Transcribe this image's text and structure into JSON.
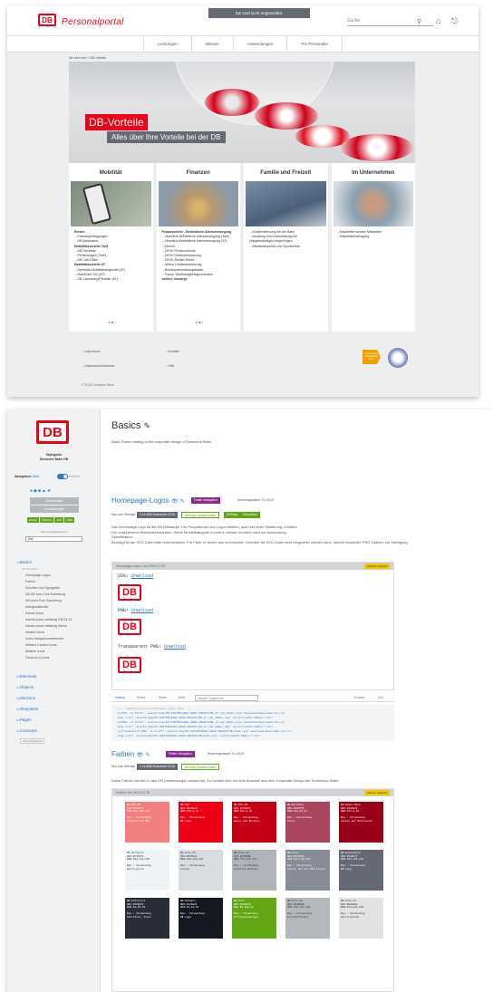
{
  "portal": {
    "logo": "DB",
    "title": "Personalportal",
    "banner": "Sie sind nicht angemeldet.",
    "search_placeholder": "Suche",
    "nav": [
      "Leistungen",
      "Wissen",
      "Anwendungen",
      "Für Personaler"
    ],
    "breadcrumb": "Sie sind hier: / DB-Vorteile",
    "hero_title": "DB-Vorteile",
    "hero_subtitle": "Alles über Ihre Vorteile bei der DB",
    "cards": [
      {
        "title": "Mobilität",
        "items": [
          {
            "h": "Reisen"
          },
          {
            "a": "Fahrvergünstigungen"
          },
          {
            "a": "DB Bahnmarkt"
          },
          {
            "h": "Mobilitätsvorteile Tarif"
          },
          {
            "a": "DB Fernreise"
          },
          {
            "a": "Firmenwagen (Tarif)"
          },
          {
            "a": "DB Call a Bike"
          },
          {
            "h": "Mobilitätsvorteile AT"
          },
          {
            "a": "Überblick Mobilitätsangebote (AT)"
          },
          {
            "a": "BahnCard 100 (AT)"
          },
          {
            "a": "DB Carsharing/Flinkster (AT)"
          }
        ]
      },
      {
        "title": "Finanzen",
        "items": [
          {
            "h": "Finanzvorteile - Betriebliche Altersversorgung"
          },
          {
            "a": "Überblick Betriebliche Altersversorgung (Tarif)"
          },
          {
            "a": "Überblick Betriebliche Altersversorgung (AT)"
          },
          {
            "a": "DirectV"
          },
          {
            "a": "DEVK Pensionsfonds"
          },
          {
            "a": "DEVK Direktversicherung"
          },
          {
            "a": "DEVK-Riester-Rente"
          },
          {
            "a": "Allianz Direktversicherung"
          },
          {
            "a": "Berufsunterstützungskasse"
          },
          {
            "a": "Fokus: Zinsflüssigkeitsgrundsätze"
          },
          {
            "h": "weitere Vorsorge"
          }
        ]
      },
      {
        "title": "Familie und Freizeit",
        "items": [
          {
            "a": "Kinderbetreuung bei der Bahn"
          },
          {
            "a": "Beratung und Unterstützung bei pflegebedürftigen Angehörigen"
          },
          {
            "a": "Mitarbeiterpreise und Sportevents"
          }
        ]
      },
      {
        "title": "Im Unternehmen",
        "items": [
          {
            "a": "Mitarbeiter werben Mitarbeiter"
          },
          {
            "a": "Mitarbeiterbefragung"
          }
        ]
      }
    ],
    "footer_links": [
      "Impressum",
      "Datenschutzhinweise",
      "Kontakt",
      "Hilfe"
    ],
    "copyright": "© 2015 Deutsche Bahn",
    "footer_badge": "Verbraucher Unternehmen Bahn"
  },
  "styleguide": {
    "logo": "DB",
    "title_line1": "Styleguide",
    "title_line2": "Deutsche Bahn HR",
    "navigation_label": "Navigation:",
    "navigation_state": "Aktiv",
    "navigation_alt": "Experimentell",
    "status_box1": "Übersichten",
    "status_box2": "Anwendungen",
    "tags": [
      "DOCK",
      "PORTAL",
      "APP",
      "CMS"
    ],
    "select_label": "Neue Layoutversionen",
    "select_value": "Alle",
    "sidebar_section": "Basics",
    "sidebar_sub": "All Templates",
    "sidebar_links": [
      "Homepage-Logos",
      "Farben",
      "Schriften und Typografie",
      "DB HR Icon Font Sammlung",
      "DB Icons Font Sammlung",
      "Anlegenaktivität",
      "Kachel-Icons",
      "Kachel-Icons vielfarbig DB-03-12",
      "Kachel-Icons vielfarbig Weiss",
      "Header-Icons",
      "Icons Navigationselemente",
      "Related Content Icons",
      "Weitere Icons",
      "Favicons & Icons"
    ],
    "sidebar_sections": [
      "Elements",
      "Objects",
      "Sections",
      "Templates",
      "Pages",
      "Concepts"
    ],
    "sidebar_all": "All Components",
    "page_title": "Basics",
    "page_desc": "Basic Rules relating to the corporate design of Deutsche Bahn",
    "logos_title": "Homepage-Logos",
    "logos_pill": "Fester Navigation",
    "logos_date": "Änderungsdatum: 9.1.2019",
    "logos_meta": "Neu zum Release",
    "logos_meta_pills": [
      "1.14 ABB Nutzeridee 2018",
      "Benötigt Spalteninhalte",
      "Defining",
      "Production"
    ],
    "logos_text": [
      "Das Homepage Logo ist die DB Bildmarke. Die Proportionen des Logos bleiben, auch bei einer Skalierung, erhalten.",
      "Der vorgesehene Mindestschutzraum: Siehe Mustelkategorie kommt in diesem Kontext nicht zur Anwendung.",
      "Spezifikation:",
      "Benötigt ist die SVG-Datei bitte herunterladen. Für Fälle, in denen aus technischen Gründen die SVG-Datei nicht eingesetzt werden kann, stehen zusätzlich PNG-Dateien zur Verfügung."
    ],
    "logos_panel_title": "Homepage-Logos: Am 2019-12-18",
    "logos_badge": "Review required",
    "downloads": [
      {
        "label": "SVG:",
        "link": "Download"
      },
      {
        "label": "PNG:",
        "link": "Download"
      },
      {
        "label": "Transparent PNG:",
        "link": "Download"
      }
    ],
    "code_tabs": [
      "Markup",
      "Status",
      "Styles",
      "Build",
      "Include Component"
    ],
    "code_actions": [
      "Expand",
      "Edit"
    ],
    "code_lines": [
      "<!-- templates/basics/homepage-logos.html -->",
      "<p>SVG: <a href=\"..assets/img/PS-93075D440E4-9D00-2MA3F3/DB_ef_rgb_100px.svg\" download>Download</a></p>",
      "<img src=\"..assets/img/PS-93075D440E4-9D00-2MA3F3/DB_ef_rgb_100px.svg\" style=\"width:100px;\"><br>",
      "<p>PNG: <a href=\"..assets/img/PS-93075D440E4-9D00-2MA3F3/DB_ef_rgb_100px.png\" download>Download</a></p>",
      "<img src=\"..assets/img/PS-93075D440E4-9D00-2MA3F3/DB_ef_rgb_100px.png\" style=\"width:100px;\"><br>",
      "<p>Transparent PNG: <a href=\"..assets/img/PS-93075D440E4-9D00-2MA3F3/DB-Kids.svg\" download>Download</a></p>",
      "<img src=\"..assets/img/PS-93075D440E4-9D00-2MA3F3/DB-Kids.svg\" style=\"width:100px;\"><br>"
    ],
    "colors_title": "Farben",
    "colors_pill": "Fester Navigation",
    "colors_date": "Änderungsdatum: 9.1.2019",
    "colors_meta": "Neu zum Release",
    "colors_meta_pills": [
      "1.14 ABB Nutzeridee 2018",
      "Benötigt Spalteninhalte"
    ],
    "colors_text": "Diese Farben werden in den HR Anwendungen verwendet. Es handelt sich um eine Auswahl aus dem Corporate Design der Deutschen Bahn.",
    "colors_panel_title": "Farben: Am 2019-12-18",
    "colors_badge": "Review required",
    "swatches": [
      {
        "bg": "#f27e7e",
        "fg": "#fff",
        "t": [
          "DB-Rot-30",
          "HEX:#F27E7E",
          "RGB:242,126,126",
          "",
          "Bsp.: Verwendung",
          "Buttons auf MIT"
        ]
      },
      {
        "bg": "#ec0016",
        "fg": "#fff",
        "t": [
          "DB-Rot",
          "HEX:#EC0016",
          "RGB:236,0,22",
          "",
          "Bsp.: Verwendung",
          "DB Logo"
        ]
      },
      {
        "bg": "#c50014",
        "fg": "#fff",
        "t": [
          "DB-Rot-80",
          "HEX:#C50014",
          "RGB:197,0,20",
          "",
          "Bsp.: Verwendung",
          "Hover auf Buttons"
        ]
      },
      {
        "bg": "#a9455d",
        "fg": "#fff",
        "t": [
          "DB-Bordeaux",
          "HEX:#A9455D",
          "RGB:169,69,93",
          "",
          "Bsp.: Verwendung",
          "Icons"
        ]
      },
      {
        "bg": "#9a001a",
        "fg": "#fff",
        "t": [
          "Bordeaux-Dark",
          "HEX:#9A001A",
          "RGB:154,0,26",
          "",
          "Bsp.: Verwendung",
          "Linien auf Startseite"
        ]
      },
      {
        "bg": "#f0f3f5",
        "fg": "#333",
        "t": [
          "DB-Hellgrau",
          "HEX:#F0F3F5",
          "RGB:240,243,245",
          "",
          "Bsp.: Verwendung",
          "Hintergrund"
        ]
      },
      {
        "bg": "#d7dce1",
        "fg": "#333",
        "t": [
          "DB-Grau-20",
          "HEX:#D7DCE1",
          "RGB:215,220,225",
          "",
          "Bsp.: Verwendung",
          "Linien"
        ]
      },
      {
        "bg": "#afb4bb",
        "fg": "#333",
        "t": [
          "DB-Grau-40",
          "HEX:#AFB4BB",
          "RGB:175,180,187",
          "",
          "Bsp.: Verwendung",
          "Inaktive Buttons"
        ]
      },
      {
        "bg": "#878c96",
        "fg": "#fff",
        "t": [
          "DB-Grau",
          "HEX:#878C96",
          "RGB:135,140,150",
          "",
          "Bsp.: Verwendung",
          "Linien auf der Startseite"
        ]
      },
      {
        "bg": "#646973",
        "fg": "#fff",
        "t": [
          "DB-Dunkelgrau",
          "HEX:#646973",
          "RGB:100,105,115",
          "",
          "Bsp.: Verwendung",
          "DB Logo"
        ]
      },
      {
        "bg": "#282d37",
        "fg": "#fff",
        "t": [
          "DB-Anthrazit",
          "HEX:#282D37",
          "RGB:40,45,55",
          "",
          "Bsp.: Verwendung",
          "Schriften, Icons"
        ]
      },
      {
        "bg": "#131821",
        "fg": "#fff",
        "t": [
          "DB-Schwarz",
          "HEX:#131821",
          "RGB:19,24,33",
          "",
          "Bsp.: Verwendung",
          "DB Logo"
        ]
      },
      {
        "bg": "#63a615",
        "fg": "#fff",
        "t": [
          "DB-Grün",
          "HEX:#63A615",
          "RGB:99,166,21",
          "",
          "Bsp.: Verwendung",
          "Erfolgsmeldungen"
        ]
      },
      {
        "bg": "#b4b8bd",
        "fg": "#333",
        "t": [
          "DB-Grau-30",
          "HEX:#B4B8BD",
          "RGB:180,184,189",
          "",
          "Bsp.: Verwendung",
          "Formularfelder"
        ]
      },
      {
        "bg": "#e0e2e4",
        "fg": "#333",
        "t": [
          "DB-Grau-10",
          "HEX:#E0E2E4",
          "RGB:224,226,228",
          "",
          "Bsp.: Verwendung",
          "Hintergründe"
        ]
      }
    ]
  },
  "colors": {
    "db_red": "#ec0016",
    "link_blue": "#2a78c6",
    "purple": "#8c2b8e",
    "green": "#63a615"
  }
}
